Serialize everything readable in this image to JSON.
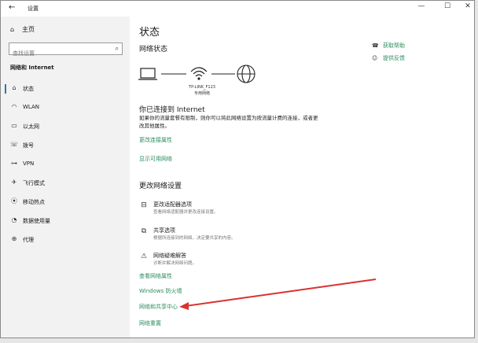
{
  "window": {
    "title": "设置",
    "back": "←",
    "minimize": "—",
    "maximize": "☐",
    "close": "✕"
  },
  "sidebar": {
    "home": "主页",
    "search_placeholder": "查找设置",
    "section": "网络和 Internet",
    "items": [
      {
        "label": "状态",
        "icon": "home-icon"
      },
      {
        "label": "WLAN",
        "icon": "wifi-icon"
      },
      {
        "label": "以太网",
        "icon": "ethernet-icon"
      },
      {
        "label": "拨号",
        "icon": "phone-icon"
      },
      {
        "label": "VPN",
        "icon": "vpn-icon"
      },
      {
        "label": "飞行模式",
        "icon": "airplane-icon"
      },
      {
        "label": "移动热点",
        "icon": "hotspot-icon"
      },
      {
        "label": "数据使用量",
        "icon": "data-usage-icon"
      },
      {
        "label": "代理",
        "icon": "globe-icon"
      }
    ]
  },
  "main": {
    "title": "状态",
    "network_status": "网络状态",
    "network_name": "TP-LINK_F123",
    "network_type": "专用网络",
    "connected_title": "你已连接到 Internet",
    "connected_desc": "如果你的流量套餐有限制，则你可以将此网络设置为按流量计费的连接，或者更改其他属性。",
    "link_change_props": "更改连接属性",
    "link_show_networks": "显示可用网络",
    "change_settings": "更改网络设置",
    "options": [
      {
        "title": "更改适配器选项",
        "desc": "查看网络适配器并更改连接设置。"
      },
      {
        "title": "共享选项",
        "desc": "根据所连接到的网络，决定要共享的内容。"
      },
      {
        "title": "网络疑难解答",
        "desc": "诊断并解决网络问题。"
      }
    ],
    "link_view_props": "查看网络属性",
    "link_firewall": "Windows 防火墙",
    "link_sharing_center": "网络和共享中心",
    "link_reset": "网络重置"
  },
  "help": {
    "get_help": "获取帮助",
    "feedback": "提供反馈"
  },
  "annotation": {
    "arrow_color": "#d93232"
  }
}
